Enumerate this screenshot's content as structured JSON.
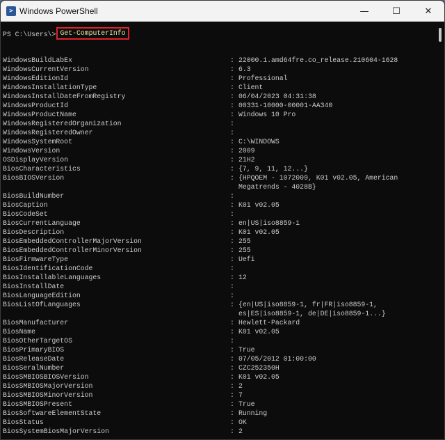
{
  "window": {
    "title": "Windows PowerShell",
    "icon": "powershell-icon",
    "minimize": "—",
    "maximize": "☐",
    "close": "✕"
  },
  "terminal": {
    "prompt": "PS C:\\Users\\>",
    "command": "Get-ComputerInfo",
    "rows": [
      {
        "key": "WindowsBuildLabEx",
        "value": "22000.1.amd64fre.co_release.210604-1628"
      },
      {
        "key": "WindowsCurrentVersion",
        "value": "6.3"
      },
      {
        "key": "WindowsEditionId",
        "value": "Professional"
      },
      {
        "key": "WindowsInstallationType",
        "value": "Client"
      },
      {
        "key": "WindowsInstallDateFromRegistry",
        "value": "06/04/2023 04:31:38"
      },
      {
        "key": "WindowsProductId",
        "value": "00331-10000-00001-AA340"
      },
      {
        "key": "WindowsProductName",
        "value": "Windows 10 Pro"
      },
      {
        "key": "WindowsRegisteredOrganization",
        "value": ""
      },
      {
        "key": "WindowsRegisteredOwner",
        "value": ""
      },
      {
        "key": "WindowsSystemRoot",
        "value": "C:\\WINDOWS"
      },
      {
        "key": "WindowsVersion",
        "value": "2009"
      },
      {
        "key": "OSDisplayVersion",
        "value": "21H2"
      },
      {
        "key": "BiosCharacteristics",
        "value": "{7, 9, 11, 12...}"
      },
      {
        "key": "BiosBIOSVersion",
        "value": "{HPQOEM - 1072009, K01 v02.05, American",
        "cont": "Megatrends - 4028B}"
      },
      {
        "key": "BiosBuildNumber",
        "value": ""
      },
      {
        "key": "BiosCaption",
        "value": "K01 v02.05"
      },
      {
        "key": "BiosCodeSet",
        "value": ""
      },
      {
        "key": "BiosCurrentLanguage",
        "value": "en|US|iso8859-1"
      },
      {
        "key": "BiosDescription",
        "value": "K01 v02.05"
      },
      {
        "key": "BiosEmbeddedControllerMajorVersion",
        "value": "255"
      },
      {
        "key": "BiosEmbeddedControllerMinorVersion",
        "value": "255"
      },
      {
        "key": "BiosFirmwareType",
        "value": "Uefi"
      },
      {
        "key": "BiosIdentificationCode",
        "value": ""
      },
      {
        "key": "BiosInstallableLanguages",
        "value": "12"
      },
      {
        "key": "BiosInstallDate",
        "value": ""
      },
      {
        "key": "BiosLanguageEdition",
        "value": ""
      },
      {
        "key": "BiosListOfLanguages",
        "value": "{en|US|iso8859-1, fr|FR|iso8859-1,",
        "cont": "es|ES|iso8859-1, de|DE|iso8859-1...}"
      },
      {
        "key": "BiosManufacturer",
        "value": "Hewlett-Packard"
      },
      {
        "key": "BiosName",
        "value": "K01 v02.05"
      },
      {
        "key": "BiosOtherTargetOS",
        "value": ""
      },
      {
        "key": "BiosPrimaryBIOS",
        "value": "True"
      },
      {
        "key": "BiosReleaseDate",
        "value": "07/05/2012 01:00:00"
      },
      {
        "key": "BiosSeralNumber",
        "value": "CZC252350H"
      },
      {
        "key": "BiosSMBIOSBIOSVersion",
        "value": "K01 v02.05"
      },
      {
        "key": "BiosSMBIOSMajorVersion",
        "value": "2"
      },
      {
        "key": "BiosSMBIOSMinorVersion",
        "value": "7"
      },
      {
        "key": "BiosSMBIOSPresent",
        "value": "True"
      },
      {
        "key": "BiosSoftwareElementState",
        "value": "Running"
      },
      {
        "key": "BiosStatus",
        "value": "OK"
      },
      {
        "key": "BiosSystemBiosMajorVersion",
        "value": "2"
      }
    ],
    "separator": ":"
  }
}
